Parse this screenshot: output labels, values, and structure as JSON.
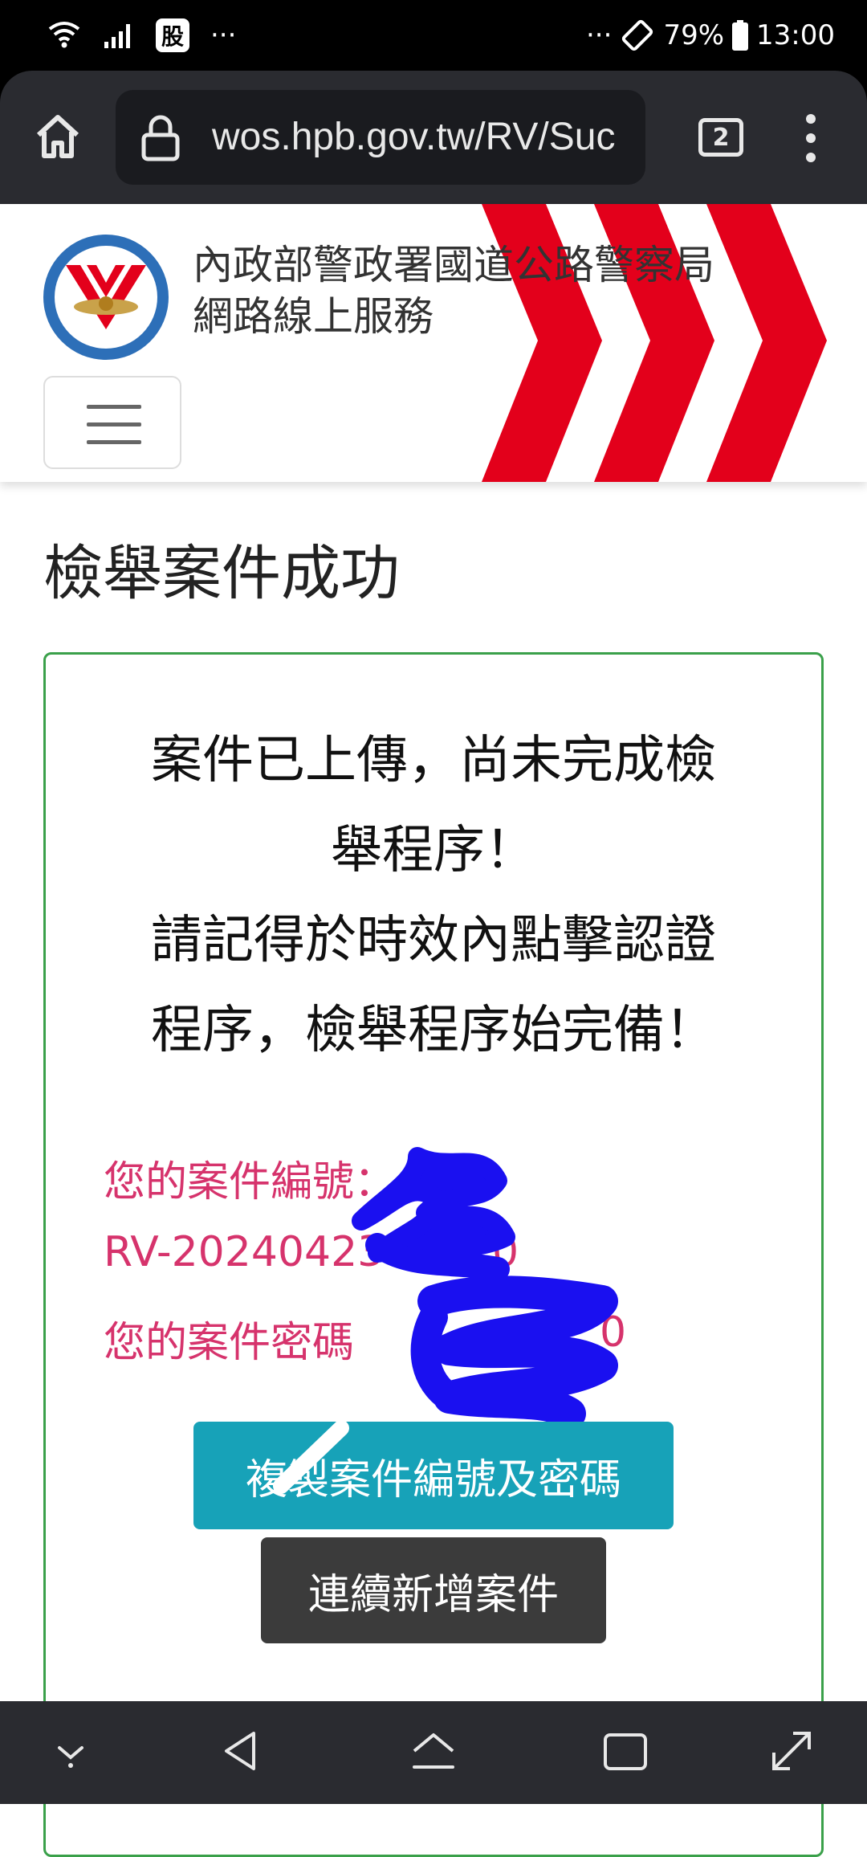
{
  "status_bar": {
    "left_app": "股",
    "left_more": "···",
    "right_more": "···",
    "battery": "79%",
    "time": "13:00"
  },
  "browser": {
    "url": "wos.hpb.gov.tw/RV/Suc",
    "tab_count": "2"
  },
  "site": {
    "title_line1": "內政部警政署國道公路警察局",
    "title_line2": "網路線上服務",
    "logo_text": "National Highway Police Bureau",
    "brand_red": "#e3001b"
  },
  "page": {
    "title": "檢舉案件成功",
    "message_lines": [
      "案件已上傳，尚未完成檢",
      "舉程序！",
      "請記得於時效內點擊認證",
      "程序，檢舉程序始完備！"
    ],
    "case_number_label": "您的案件編號：",
    "case_number_value": "RV-20240423",
    "case_number_tail": "0",
    "case_password_label": "您的案件密碼",
    "case_password_tail": "0",
    "copy_button": "複製案件編號及密碼",
    "new_case_button": "連續新增案件"
  },
  "colors": {
    "copy_button": "#17a2b8",
    "new_case_button": "#3b3b3b",
    "card_border": "#3aa04a",
    "case_text": "#d6336c",
    "scribble": "#1a10f0"
  }
}
